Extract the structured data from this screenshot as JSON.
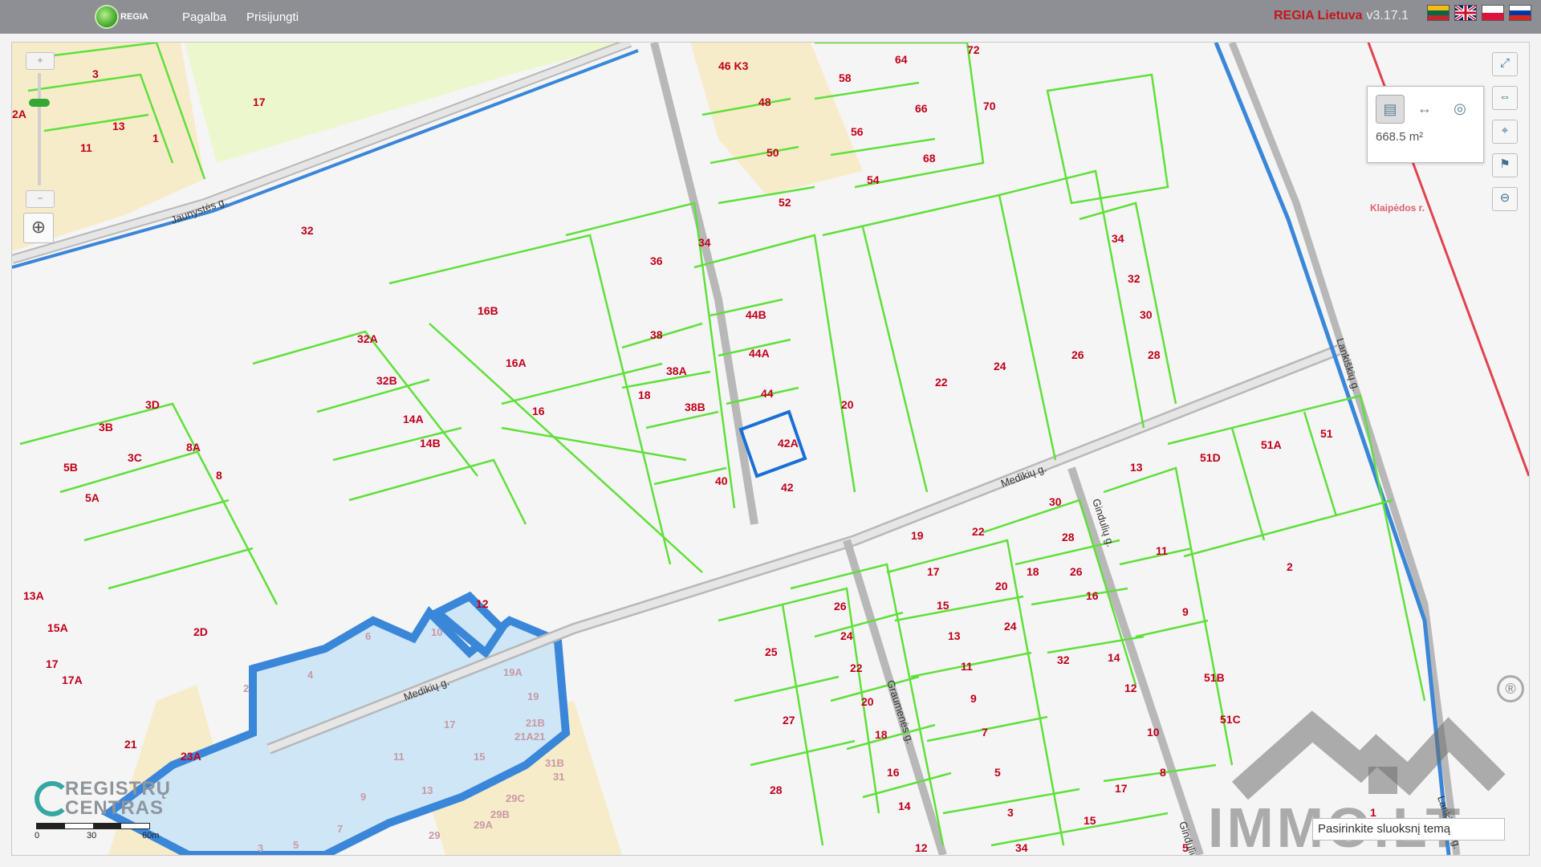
{
  "header": {
    "logo_text": "REGIA",
    "nav": [
      "Pagalba",
      "Prisijungti"
    ],
    "brand": "REGIA Lietuva",
    "version": "v3.17.1",
    "languages": [
      "lt",
      "en",
      "pl",
      "ru"
    ]
  },
  "map": {
    "zoom_in": "+",
    "zoom_out": "−",
    "measure": {
      "area": "668.5 m²",
      "active_tool": "area"
    },
    "layer_placeholder": "Pasirinkite sluoksnį temą",
    "scale": [
      "0",
      "30",
      "60m"
    ],
    "attribution": "REGISTRŲ CENTRAS",
    "watermark": "IMMO.LT",
    "watermark_mark": "®",
    "place_label": "Klaipėdos r.",
    "streets": [
      "Jaunystės g.",
      "Medikių g.",
      "Medikių g.",
      "Gindulių g.",
      "Gindulių g.",
      "Graumenės g.",
      "Lankiškių g.",
      "Lankiškių g."
    ],
    "parcels": [
      "46 K3",
      "64",
      "72",
      "17",
      "3",
      "2A",
      "13",
      "11",
      "1",
      "58",
      "48",
      "66",
      "70",
      "56",
      "50",
      "68",
      "54",
      "52",
      "32",
      "36",
      "34",
      "34",
      "32",
      "30",
      "28",
      "26",
      "16B",
      "16A",
      "38",
      "38A",
      "38B",
      "44B",
      "44A",
      "44",
      "42A",
      "20",
      "22",
      "24",
      "42",
      "40",
      "18",
      "16",
      "32A",
      "32B",
      "14A",
      "14B",
      "3D",
      "3B",
      "8A",
      "3C",
      "8",
      "5B",
      "5A",
      "13A",
      "15A",
      "17",
      "17A",
      "2D",
      "2",
      "12",
      "10",
      "6",
      "4",
      "19A",
      "19",
      "21B",
      "21A21",
      "17",
      "15",
      "11",
      "13",
      "9",
      "7",
      "5",
      "3",
      "23A",
      "21",
      "31B",
      "31",
      "29C",
      "29B",
      "29A",
      "29",
      "25",
      "27",
      "28",
      "26",
      "24",
      "22",
      "20",
      "18",
      "16",
      "14",
      "12",
      "19",
      "17",
      "15",
      "13",
      "11",
      "9",
      "7",
      "5",
      "3",
      "34",
      "22",
      "20",
      "24",
      "18",
      "32",
      "30",
      "28",
      "26",
      "16",
      "14",
      "12",
      "10",
      "8",
      "17",
      "15",
      "13",
      "11",
      "9",
      "51B",
      "51C",
      "51D",
      "51A",
      "51",
      "2",
      "1",
      "5"
    ]
  }
}
